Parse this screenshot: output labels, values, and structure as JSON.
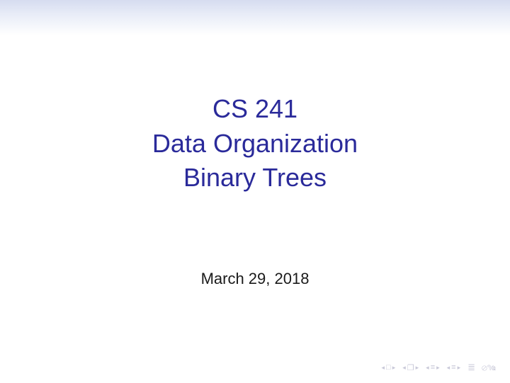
{
  "title": {
    "line1": "CS 241",
    "line2": "Data Organization",
    "line3": "Binary Trees"
  },
  "date": "March 29, 2018",
  "nav": {
    "frame": "□",
    "section": "❐",
    "subsection": "≡",
    "item": "≡",
    "back": "↰",
    "refresh": "⟲⇆⊘"
  }
}
